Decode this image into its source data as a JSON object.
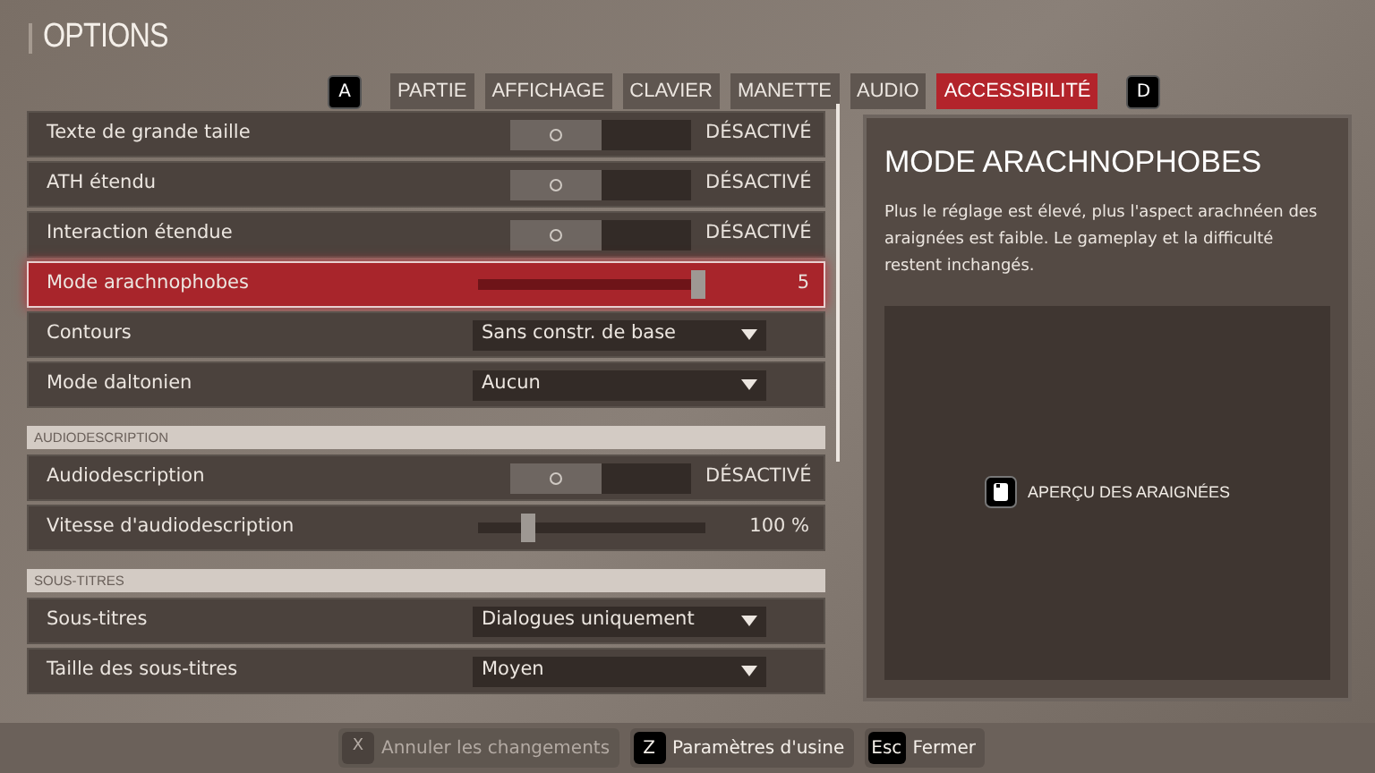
{
  "title": "OPTIONS",
  "tab_keys": {
    "prev": "A",
    "next": "D"
  },
  "tabs": [
    {
      "label": "PARTIE",
      "selected": false
    },
    {
      "label": "AFFICHAGE",
      "selected": false
    },
    {
      "label": "CLAVIER",
      "selected": false
    },
    {
      "label": "MANETTE",
      "selected": false
    },
    {
      "label": "AUDIO",
      "selected": false
    },
    {
      "label": "ACCESSIBILITÉ",
      "selected": true
    }
  ],
  "settings": [
    {
      "kind": "toggle",
      "label": "Texte de grande taille",
      "on": false,
      "value": "DÉSACTIVÉ",
      "selected": false
    },
    {
      "kind": "toggle",
      "label": "ATH étendu",
      "on": false,
      "value": "DÉSACTIVÉ",
      "selected": false
    },
    {
      "kind": "toggle",
      "label": "Interaction étendue",
      "on": false,
      "value": "DÉSACTIVÉ",
      "selected": false
    },
    {
      "kind": "slider",
      "label": "Mode arachnophobes",
      "level": 1,
      "value": "5",
      "selected": true
    },
    {
      "kind": "dropdown",
      "label": "Contours",
      "value": "Sans constr. de base",
      "selected": false
    },
    {
      "kind": "dropdown",
      "label": "Mode daltonien",
      "value": "Aucun",
      "selected": false
    },
    {
      "kind": "section",
      "label": "AUDIODESCRIPTION"
    },
    {
      "kind": "toggle",
      "label": "Audiodescription",
      "on": false,
      "value": "DÉSACTIVÉ",
      "selected": false
    },
    {
      "kind": "slider",
      "label": "Vitesse d'audiodescription",
      "level": 0.2,
      "value": "100 %",
      "selected": false
    },
    {
      "kind": "section",
      "label": "SOUS-TITRES"
    },
    {
      "kind": "dropdown",
      "label": "Sous-titres",
      "value": "Dialogues uniquement",
      "selected": false
    },
    {
      "kind": "dropdown",
      "label": "Taille des sous-titres",
      "value": "Moyen",
      "selected": false
    }
  ],
  "detail": {
    "title": "MODE ARACHNOPHOBES",
    "description": "Plus le réglage est élevé, plus l'aspect arachnéen des araignées est faible. Le gameplay et la difficulté restent inchangés.",
    "preview_label": "APERÇU DES ARAIGNÉES"
  },
  "footer": [
    {
      "key": "X",
      "label": "Annuler les changements",
      "disabled": true
    },
    {
      "key": "Z",
      "label": "Paramètres d'usine",
      "disabled": false
    },
    {
      "key": "Esc",
      "label": "Fermer",
      "disabled": false
    }
  ]
}
